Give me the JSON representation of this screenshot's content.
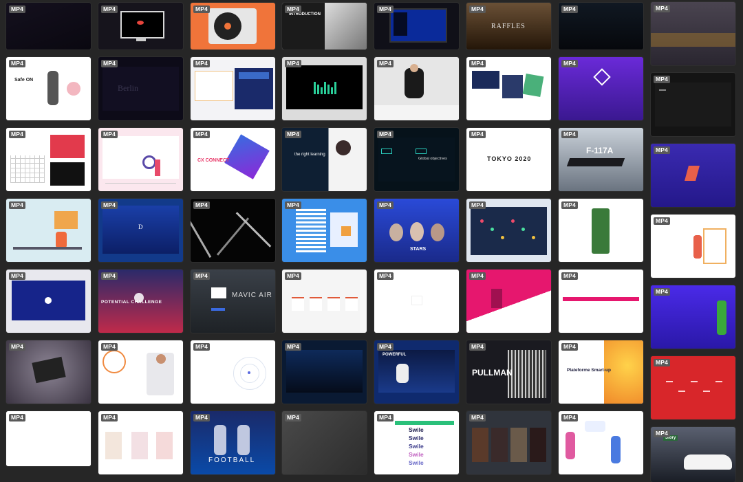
{
  "badge_label": "MP4",
  "columns": [
    {
      "tiles": [
        {
          "h": 68,
          "bg": "#0c0a14",
          "kind": "dark"
        },
        {
          "h": 92,
          "bg": "#ffffff",
          "kind": "product",
          "title": "Safe ON"
        },
        {
          "h": 92,
          "bg": "#f2f2f2",
          "kind": "calendar"
        },
        {
          "h": 92,
          "bg": "#d9ecf2",
          "kind": "office"
        },
        {
          "h": 92,
          "bg": "#e8e8ee",
          "kind": "bluebox"
        },
        {
          "h": 92,
          "bg": "#5b5566",
          "kind": "aerial"
        },
        {
          "h": 80,
          "bg": "#ffffff",
          "kind": "blank"
        }
      ]
    },
    {
      "tiles": [
        {
          "h": 68,
          "bg": "#16141c",
          "kind": "monitor"
        },
        {
          "h": 92,
          "bg": "#0d0b18",
          "kind": "darkblue",
          "title": "Berlin"
        },
        {
          "h": 92,
          "bg": "#fbe7ee",
          "kind": "magnifier"
        },
        {
          "h": 92,
          "bg": "#123a8a",
          "kind": "bluegrad",
          "title": "D"
        },
        {
          "h": 92,
          "bg": "#7a1f3d",
          "kind": "stadium",
          "title": "POTENTIAL   CHALLENGE"
        },
        {
          "h": 92,
          "bg": "#ffffff",
          "kind": "person"
        },
        {
          "h": 92,
          "bg": "#ffffff",
          "kind": "frames"
        }
      ]
    },
    {
      "tiles": [
        {
          "h": 68,
          "bg": "#f0743a",
          "kind": "turntable"
        },
        {
          "h": 92,
          "bg": "#f3f3f6",
          "kind": "texts"
        },
        {
          "h": 92,
          "bg": "#ffffff",
          "kind": "cube",
          "title": "CX CONNECT"
        },
        {
          "h": 92,
          "bg": "#050505",
          "kind": "lines"
        },
        {
          "h": 92,
          "bg": "#2b2e33",
          "kind": "drone",
          "title": "MAVIC AIR"
        },
        {
          "h": 92,
          "bg": "#ffffff",
          "kind": "rings"
        },
        {
          "h": 92,
          "bg": "#1a3e8a",
          "kind": "football",
          "title": "FOOTBALL"
        }
      ]
    },
    {
      "tiles": [
        {
          "h": 68,
          "bg": "#e8e8e8",
          "kind": "intro",
          "title": "INTRODUCTION"
        },
        {
          "h": 92,
          "bg": "#dcdcdc",
          "kind": "equalizer"
        },
        {
          "h": 92,
          "bg": "#0e1f33",
          "kind": "headset",
          "title": "the right learning"
        },
        {
          "h": 92,
          "bg": "#3a8ee8",
          "kind": "city"
        },
        {
          "h": 92,
          "bg": "#f5f5f5",
          "kind": "columns"
        },
        {
          "h": 92,
          "bg": "#0a1a33",
          "kind": "night"
        },
        {
          "h": 92,
          "bg": "#3a3a3a",
          "kind": "texture"
        }
      ]
    },
    {
      "tiles": [
        {
          "h": 68,
          "bg": "#101018",
          "kind": "monitor2"
        },
        {
          "h": 92,
          "bg": "#e6e6e6",
          "kind": "girl"
        },
        {
          "h": 92,
          "bg": "#06121a",
          "kind": "objectives",
          "title": "Global objectives"
        },
        {
          "h": 92,
          "bg": "#1d3fa8",
          "kind": "faces",
          "title": "STARS"
        },
        {
          "h": 92,
          "bg": "#ffffff",
          "kind": "plain"
        },
        {
          "h": 92,
          "bg": "#0f2a6e",
          "kind": "tennis",
          "title": "POWERFUL"
        },
        {
          "h": 92,
          "bg": "#ffffff",
          "kind": "swile",
          "title": "Swile"
        }
      ]
    },
    {
      "tiles": [
        {
          "h": 68,
          "bg": "#3a2a1a",
          "kind": "raffles",
          "title": "RAFFLES"
        },
        {
          "h": 92,
          "bg": "#ffffff",
          "kind": "cards"
        },
        {
          "h": 92,
          "bg": "#ffffff",
          "kind": "tokyo",
          "title": "TOKYO 2020"
        },
        {
          "h": 92,
          "bg": "#dfe6f0",
          "kind": "map"
        },
        {
          "h": 92,
          "bg": "#e6176e",
          "kind": "pink"
        },
        {
          "h": 92,
          "bg": "#1a1a20",
          "kind": "pullman",
          "title": "PULLMAN"
        },
        {
          "h": 92,
          "bg": "#30343c",
          "kind": "posters"
        }
      ]
    },
    {
      "tiles": [
        {
          "h": 68,
          "bg": "#0a0e14",
          "kind": "darkscreen"
        },
        {
          "h": 92,
          "bg": "#4a1fa8",
          "kind": "purple"
        },
        {
          "h": 92,
          "bg": "#9aa6b2",
          "kind": "jet",
          "title": "F-117A"
        },
        {
          "h": 92,
          "bg": "#ffffff",
          "kind": "phone"
        },
        {
          "h": 92,
          "bg": "#ffffff",
          "kind": "pinkbar"
        },
        {
          "h": 92,
          "bg": "#ffffff",
          "kind": "smartup",
          "title": "Plateforme Smart-up"
        },
        {
          "h": 92,
          "bg": "#ffffff",
          "kind": "chat"
        }
      ]
    },
    {
      "tiles": [
        {
          "h": 92,
          "bg": "#3a3640",
          "kind": "building"
        },
        {
          "h": 92,
          "bg": "#141414",
          "kind": "terminal"
        },
        {
          "h": 92,
          "bg": "#3a2aa8",
          "kind": "claw"
        },
        {
          "h": 92,
          "bg": "#ffffff",
          "kind": "easel"
        },
        {
          "h": 92,
          "bg": "#3e22d8",
          "kind": "can"
        },
        {
          "h": 92,
          "bg": "#d8262a",
          "kind": "redmap"
        },
        {
          "h": 80,
          "bg": "#2a2e36",
          "kind": "car",
          "title": "Story"
        }
      ]
    }
  ]
}
